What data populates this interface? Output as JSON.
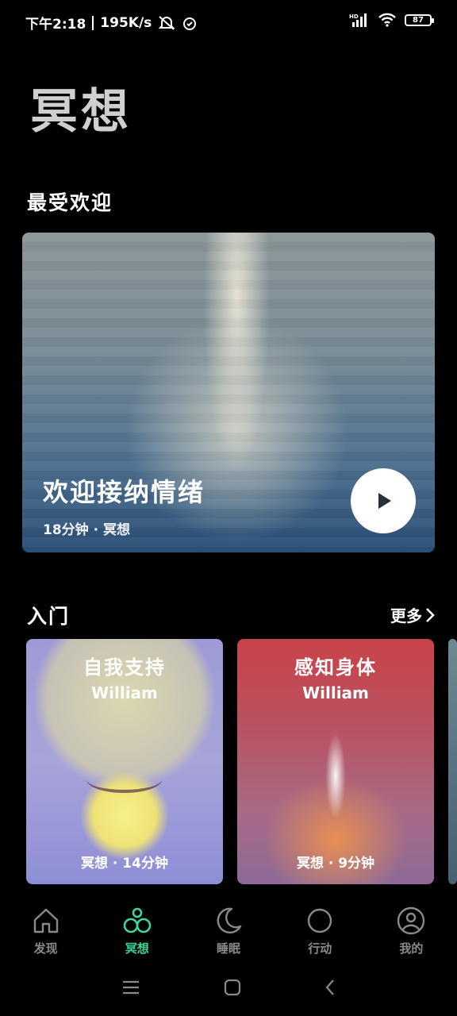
{
  "status_bar": {
    "time": "下午2:18",
    "network_speed": "195K/s",
    "battery": "87",
    "signal_label": "HD",
    "icons": [
      "mute-icon",
      "alarm-icon",
      "signal-icon",
      "wifi-icon",
      "battery-icon"
    ]
  },
  "page": {
    "title": "冥想"
  },
  "popular": {
    "section_title": "最受欢迎",
    "hero": {
      "title": "欢迎接纳情绪",
      "meta": "18分钟 · 冥想"
    }
  },
  "beginner": {
    "section_title": "入门",
    "more_label": "更多",
    "cards": [
      {
        "title": "自我支持",
        "author": "William",
        "meta": "冥想 · 14分钟"
      },
      {
        "title": "感知身体",
        "author": "William",
        "meta": "冥想 · 9分钟"
      }
    ]
  },
  "bottom_nav": {
    "items": [
      {
        "label": "发现",
        "icon": "home-icon"
      },
      {
        "label": "冥想",
        "icon": "meditation-icon",
        "active": true
      },
      {
        "label": "睡眠",
        "icon": "moon-icon"
      },
      {
        "label": "行动",
        "icon": "circle-icon"
      },
      {
        "label": "我的",
        "icon": "profile-icon"
      }
    ]
  },
  "colors": {
    "active": "#3fd59b",
    "inactive": "#8a8a8a",
    "background": "#000000"
  }
}
